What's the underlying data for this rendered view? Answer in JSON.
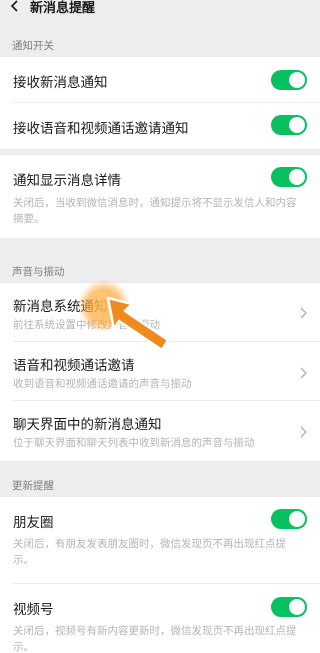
{
  "header": {
    "title": "新消息提醒"
  },
  "sections": {
    "notify": {
      "label": "通知开关"
    },
    "sound": {
      "label": "声音与振动"
    },
    "update": {
      "label": "更新提醒"
    }
  },
  "rows": {
    "receive_new": {
      "title": "接收新消息通知",
      "enabled": true
    },
    "receive_call": {
      "title": "接收语音和视频通话邀请通知",
      "enabled": true
    },
    "show_detail": {
      "title": "通知显示消息详情",
      "desc": "关闭后，当收到微信消息时，通知提示将不显示发信人和内容摘要。",
      "enabled": true
    },
    "system_notify": {
      "title": "新消息系统通知",
      "desc": "前往系统设置中修改声音与振动"
    },
    "call_invite": {
      "title": "语音和视频通话邀请",
      "desc": "收到语音和视频通话邀请的声音与振动"
    },
    "in_chat": {
      "title": "聊天界面中的新消息通知",
      "desc": "位于聊天界面和聊天列表中收到新消息的声音与振动"
    },
    "moments": {
      "title": "朋友圈",
      "desc": "关闭后，有朋友发表朋友圈时，微信发现页不再出现红点提示。",
      "enabled": true
    },
    "channels": {
      "title": "视频号",
      "desc": "关闭后，视频号有新内容更新时，微信发现页不再出现红点提示。",
      "enabled": true
    }
  },
  "colors": {
    "toggle_on": "#07c160",
    "background": "#ededed",
    "cursor": "#f08a1e"
  }
}
